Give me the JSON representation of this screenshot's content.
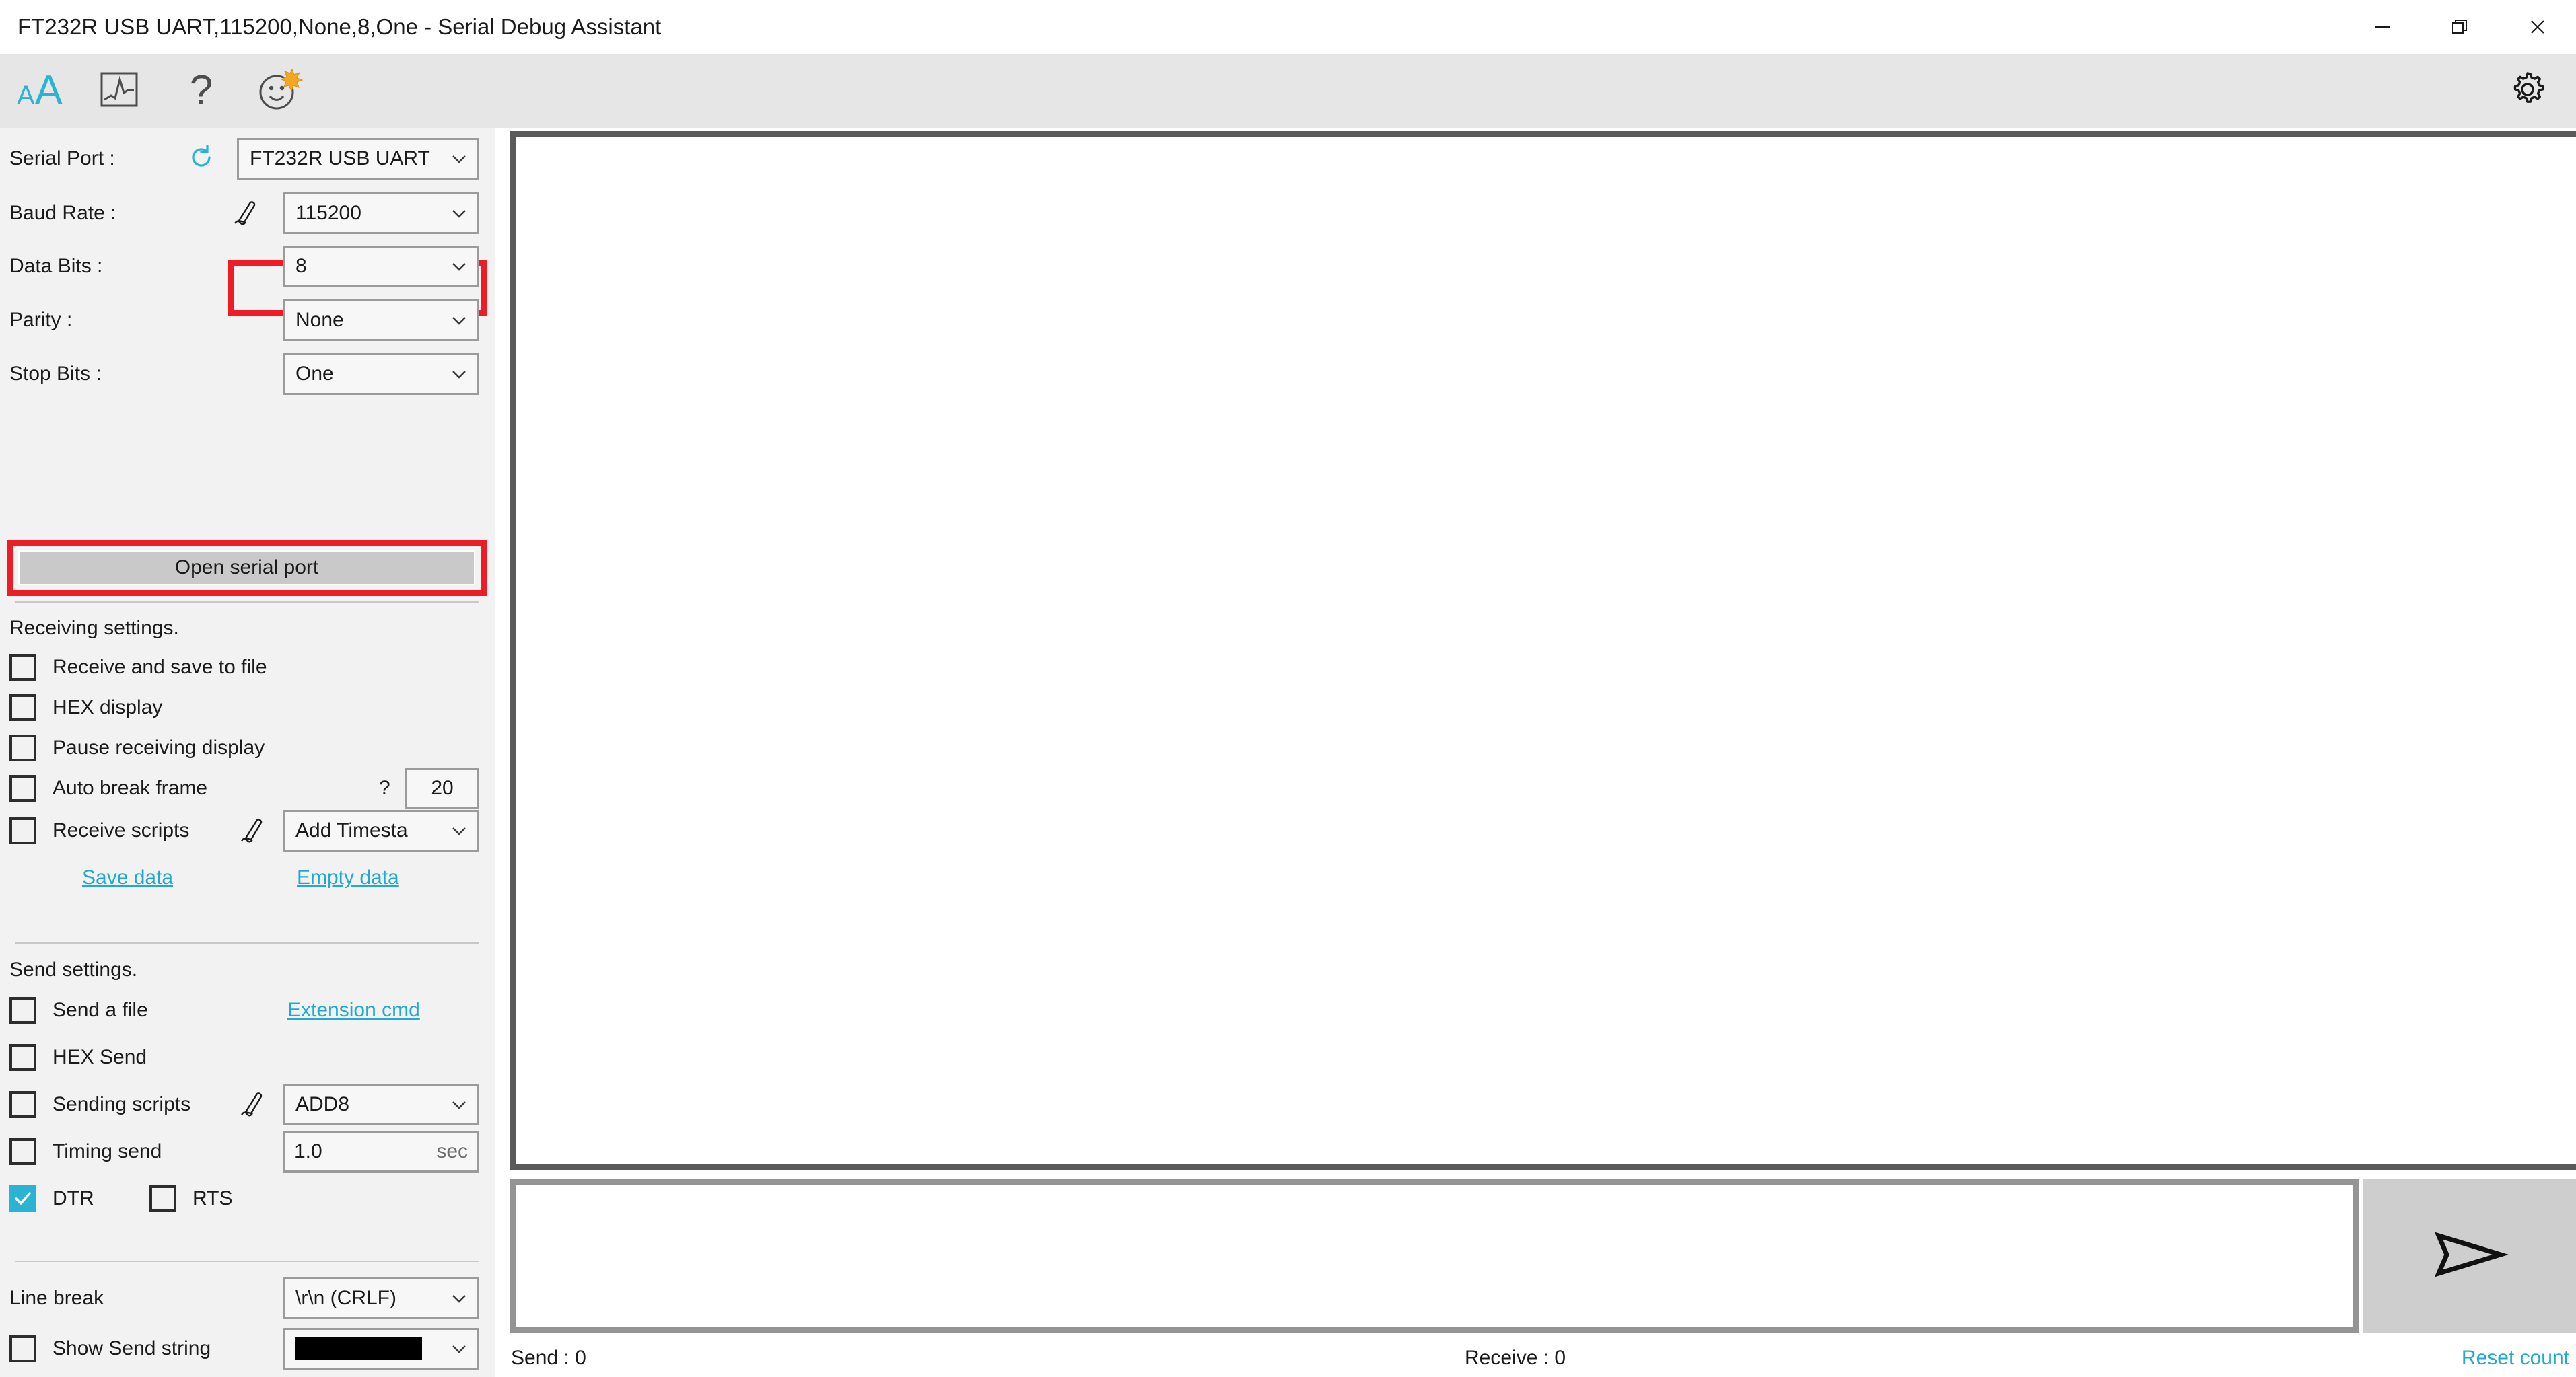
{
  "window": {
    "title": "FT232R USB UART,115200,None,8,One - Serial Debug Assistant",
    "controls": {
      "minimize": "minimize-icon",
      "restore": "restore-icon",
      "close": "close-icon"
    }
  },
  "toolbar": {
    "items": [
      {
        "name": "font-size-icon",
        "glyph": "AA"
      },
      {
        "name": "waveform-plot-icon",
        "glyph": ""
      },
      {
        "name": "help-icon",
        "glyph": "?"
      },
      {
        "name": "smiley-icon",
        "glyph": ""
      }
    ],
    "settings": {
      "name": "gear-icon"
    }
  },
  "sidebar": {
    "serial": {
      "port_label": "Serial Port :",
      "port_value": "FT232R USB UART",
      "refresh_icon": "refresh-icon",
      "baud_label": "Baud Rate :",
      "baud_value": "115200",
      "baud_script_icon": "script-pen-icon",
      "data_bits_label": "Data Bits :",
      "data_bits_value": "8",
      "parity_label": "Parity :",
      "parity_value": "None",
      "stop_bits_label": "Stop Bits :",
      "stop_bits_value": "One",
      "open_button": "Open serial port"
    },
    "receiving": {
      "title": "Receiving settings.",
      "save_to_file": "Receive and save to file",
      "hex_display": "HEX display",
      "pause_display": "Pause receiving display",
      "auto_break_frame": "Auto break frame",
      "auto_break_help": "?",
      "auto_break_value": "20",
      "receive_scripts": "Receive scripts",
      "receive_scripts_icon": "script-pen-icon",
      "receive_scripts_value": "Add Timesta",
      "save_data_link": "Save data",
      "empty_data_link": "Empty data"
    },
    "sending": {
      "title": "Send settings.",
      "send_a_file": "Send a file",
      "extension_cmd_link": "Extension cmd",
      "hex_send": "HEX Send",
      "sending_scripts": "Sending scripts",
      "sending_scripts_icon": "script-pen-icon",
      "sending_scripts_value": "ADD8",
      "timing_send": "Timing send",
      "timing_value": "1.0",
      "timing_unit": "sec",
      "dtr_label": "DTR",
      "rts_label": "RTS"
    },
    "linebreak": {
      "label": "Line break",
      "value": "\\r\\n (CRLF)",
      "show_send_string": "Show Send string",
      "color_value": "#000000"
    }
  },
  "receive_area": {
    "content": ""
  },
  "send_area": {
    "content": "",
    "send_button_icon": "send-paper-plane-icon"
  },
  "statusbar": {
    "send_count": "Send : 0",
    "receive_count": "Receive : 0",
    "reset_link": "Reset count"
  },
  "colors": {
    "accent": "#2bb3d4",
    "link": "#22a9cf",
    "highlight": "#ee1c25",
    "toolbar_bg": "#e6e6e6",
    "sidebar_bg": "#f2f2f2"
  }
}
